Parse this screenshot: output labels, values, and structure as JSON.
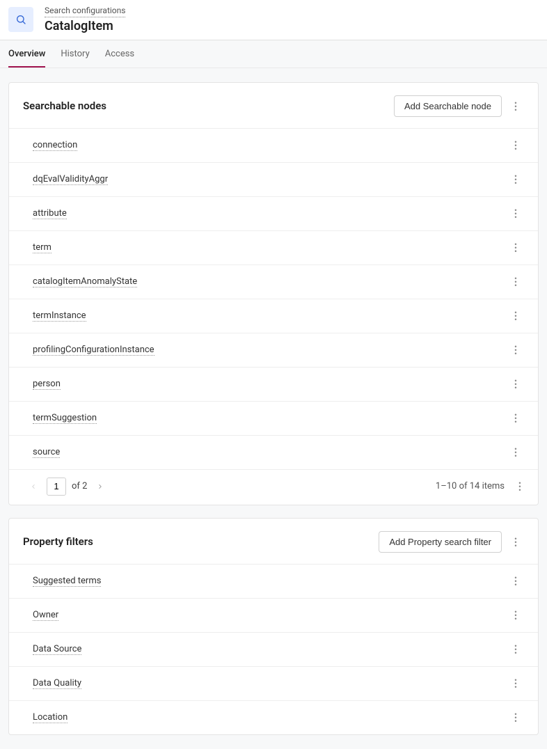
{
  "header": {
    "breadcrumb": "Search configurations",
    "title": "CatalogItem"
  },
  "tabs": [
    {
      "label": "Overview",
      "active": true
    },
    {
      "label": "History",
      "active": false
    },
    {
      "label": "Access",
      "active": false
    }
  ],
  "searchable_nodes": {
    "title": "Searchable nodes",
    "add_button": "Add Searchable node",
    "items": [
      "connection",
      "dqEvalValidityAggr",
      "attribute",
      "term",
      "catalogItemAnomalyState",
      "termInstance",
      "profilingConfigurationInstance",
      "person",
      "termSuggestion",
      "source"
    ],
    "pagination": {
      "current_page": "1",
      "of_label": "of 2",
      "range_label": "1–10 of 14 items"
    }
  },
  "property_filters": {
    "title": "Property filters",
    "add_button": "Add Property search filter",
    "items": [
      "Suggested terms",
      "Owner",
      "Data Source",
      "Data Quality",
      "Location"
    ]
  }
}
